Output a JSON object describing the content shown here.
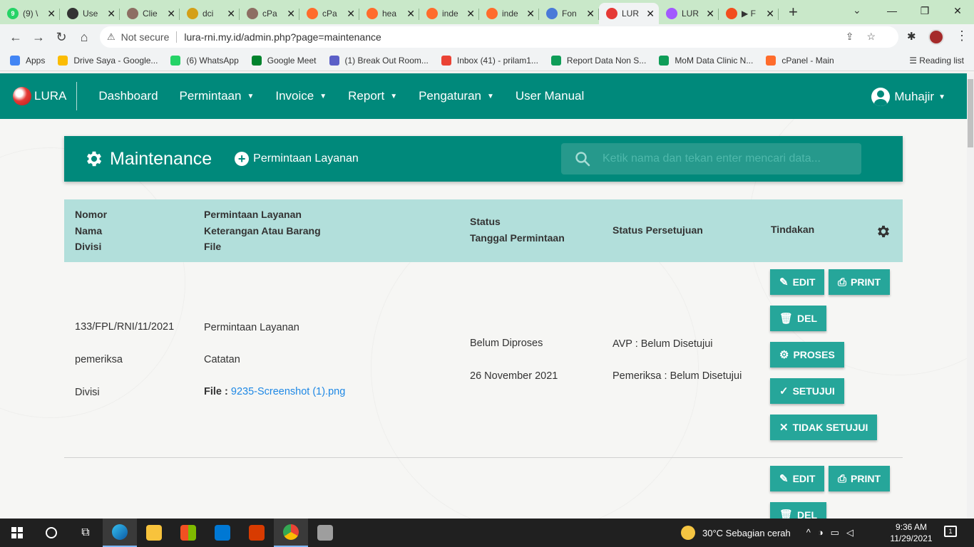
{
  "browser": {
    "tabs": [
      {
        "title": "(9) \\",
        "color": "#25d366",
        "glyph": "9"
      },
      {
        "title": "Use",
        "color": "#333333",
        "glyph": ""
      },
      {
        "title": "Clie",
        "color": "#8d6e63",
        "glyph": ""
      },
      {
        "title": "dci",
        "color": "#d4a017",
        "glyph": ""
      },
      {
        "title": "cPa",
        "color": "#8d6e63",
        "glyph": ""
      },
      {
        "title": "cPa",
        "color": "#ff6c2c",
        "glyph": ""
      },
      {
        "title": "hea",
        "color": "#ff6c2c",
        "glyph": ""
      },
      {
        "title": "inde",
        "color": "#ff6c2c",
        "glyph": ""
      },
      {
        "title": "inde",
        "color": "#ff6c2c",
        "glyph": ""
      },
      {
        "title": "Fon",
        "color": "#4a7ad8",
        "glyph": ""
      },
      {
        "title": "LUR",
        "color": "#e53935",
        "glyph": "",
        "active": true
      },
      {
        "title": "LUR",
        "color": "#a259ff",
        "glyph": ""
      },
      {
        "title": "▶ F",
        "color": "#f24e1e",
        "glyph": ""
      }
    ],
    "omnibox": {
      "security": "Not secure",
      "url": "lura-rni.my.id/admin.php?page=maintenance"
    },
    "bookmarks": [
      {
        "label": "Apps",
        "color": "#4285f4"
      },
      {
        "label": "Drive Saya - Google...",
        "color": "#fbbc04"
      },
      {
        "label": "(6) WhatsApp",
        "color": "#25d366"
      },
      {
        "label": "Google Meet",
        "color": "#00832d"
      },
      {
        "label": "(1) Break Out Room...",
        "color": "#5b5fc7"
      },
      {
        "label": "Inbox (41) - prilam1...",
        "color": "#ea4335"
      },
      {
        "label": "Report Data Non S...",
        "color": "#0f9d58"
      },
      {
        "label": "MoM Data Clinic N...",
        "color": "#0f9d58"
      },
      {
        "label": "cPanel - Main",
        "color": "#ff6c2c"
      }
    ],
    "reading_list": "Reading list"
  },
  "app": {
    "logo_text": "LURA",
    "nav": [
      "Dashboard",
      "Permintaan",
      "Invoice",
      "Report",
      "Pengaturan",
      "User Manual"
    ],
    "user": "Muhajir",
    "accent": "#00897b"
  },
  "panel": {
    "title": "Maintenance",
    "add_label": "Permintaan Layanan",
    "search_placeholder": "Ketik nama dan tekan enter mencari data..."
  },
  "table": {
    "headers": {
      "col1": [
        "Nomor",
        "Nama",
        "Divisi"
      ],
      "col2": [
        "Permintaan Layanan",
        "Keterangan Atau Barang",
        "File"
      ],
      "col3": [
        "Status",
        "Tanggal Permintaan"
      ],
      "col4": "Status Persetujuan",
      "col5": "Tindakan"
    },
    "rows": [
      {
        "nomor": "133/FPL/RNI/11/2021",
        "nama": "pemeriksa",
        "divisi": "Divisi",
        "permintaan": "Permintaan Layanan",
        "keterangan": "Catatan",
        "file_label": "File :",
        "file_name": "9235-Screenshot (1).png",
        "status": "Belum Diproses",
        "tanggal": "26 November 2021",
        "avp": "AVP : Belum Disetujui",
        "pemeriksa": "Pemeriksa : Belum Disetujui"
      }
    ],
    "actions": {
      "edit": "EDIT",
      "print": "PRINT",
      "del": "DEL",
      "proses": "PROSES",
      "setujui": "SETUJUI",
      "tidak": "TIDAK SETUJUI"
    }
  },
  "taskbar": {
    "weather": "30°C  Sebagian cerah",
    "time": "9:36 AM",
    "date": "11/29/2021",
    "notif_count": "1"
  }
}
